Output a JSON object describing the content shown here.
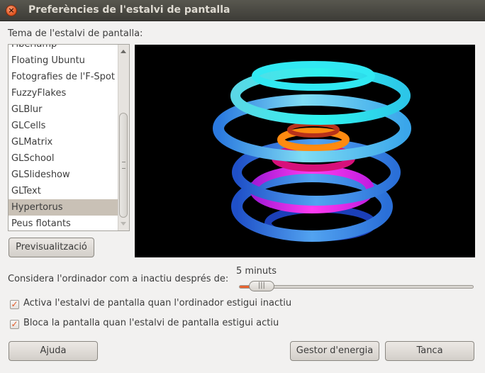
{
  "window": {
    "title": "Preferències de l'estalvi de pantalla",
    "close_glyph": "×"
  },
  "theme_label": "Tema de l'estalvi de pantalla:",
  "theme_list": {
    "items": [
      "Fiberlamp",
      "Floating Ubuntu",
      "Fotografies de l'F-Spot",
      "FuzzyFlakes",
      "GLBlur",
      "GLCells",
      "GLMatrix",
      "GLSchool",
      "GLSlideshow",
      "GLText",
      "Hypertorus",
      "Peus flotants"
    ],
    "selected": "Hypertorus"
  },
  "preview_button": "Previsualització",
  "idle": {
    "label": "Considera l'ordinador com a inactiu després de:",
    "value_text": "5 minuts",
    "slider_fraction": 0.06,
    "handle_glyph": "|||"
  },
  "options": {
    "activate_label": "Activa l'estalvi de pantalla quan l'ordinador estigui inactiu",
    "activate_checked": true,
    "lock_label": "Bloca la pantalla quan l'estalvi de pantalla estigui actiu",
    "lock_checked": true,
    "check_glyph": "✓"
  },
  "buttons": {
    "help": "Ajuda",
    "power": "Gestor d'energia",
    "close": "Tanca"
  },
  "colors": {
    "accent": "#e8632f",
    "selection": "#c9c1b6",
    "preview_background": "#000000"
  }
}
